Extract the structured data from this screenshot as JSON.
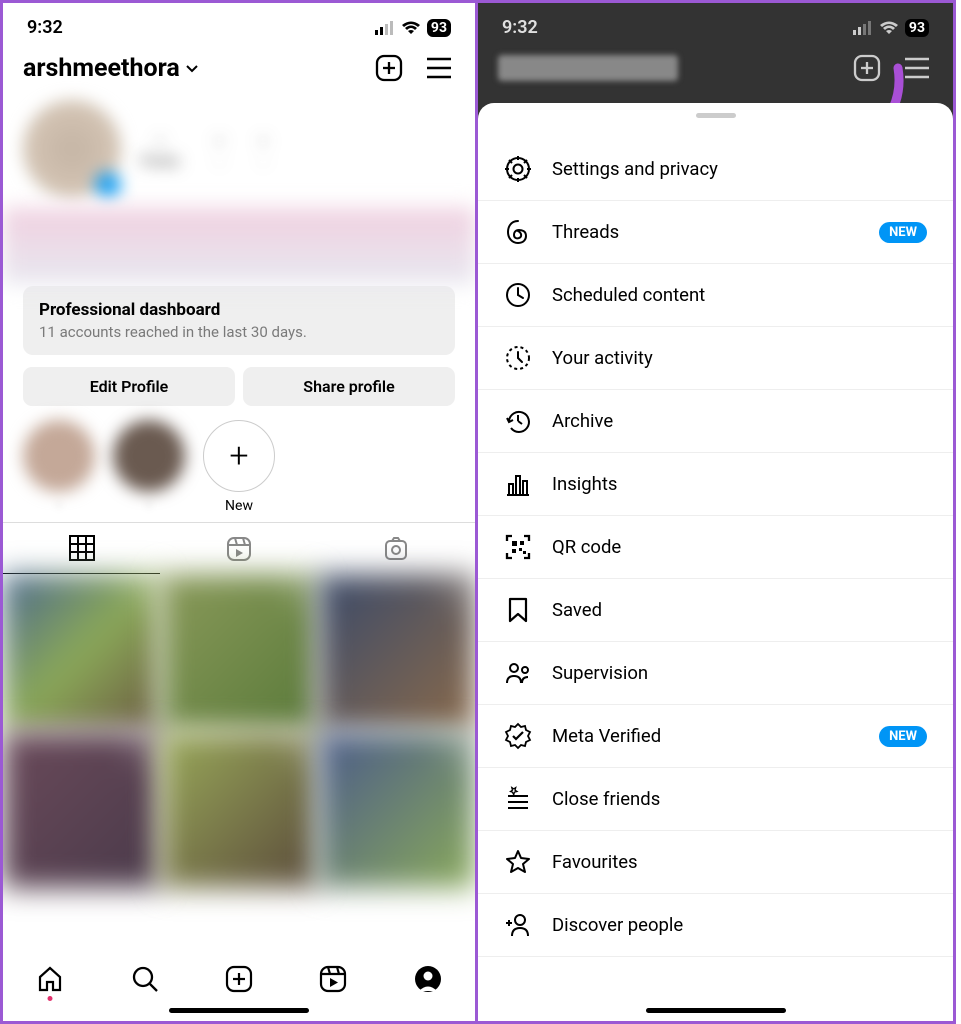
{
  "status": {
    "time": "9:32",
    "battery": "93"
  },
  "profile": {
    "username": "arshmeethora",
    "posts_label": "Posts",
    "dash_title": "Professional dashboard",
    "dash_sub": "11 accounts reached in the last 30 days.",
    "edit_btn": "Edit Profile",
    "share_btn": "Share profile",
    "highlight_new": "New"
  },
  "menu": {
    "items": [
      {
        "label": "Settings and privacy",
        "icon": "gear"
      },
      {
        "label": "Threads",
        "icon": "threads",
        "badge": "NEW"
      },
      {
        "label": "Scheduled content",
        "icon": "clock"
      },
      {
        "label": "Your activity",
        "icon": "activity"
      },
      {
        "label": "Archive",
        "icon": "archive"
      },
      {
        "label": "Insights",
        "icon": "insights"
      },
      {
        "label": "QR code",
        "icon": "qr"
      },
      {
        "label": "Saved",
        "icon": "saved"
      },
      {
        "label": "Supervision",
        "icon": "supervision"
      },
      {
        "label": "Meta Verified",
        "icon": "verified",
        "badge": "NEW"
      },
      {
        "label": "Close friends",
        "icon": "closefriends"
      },
      {
        "label": "Favourites",
        "icon": "star"
      },
      {
        "label": "Discover people",
        "icon": "discover"
      }
    ]
  },
  "colors": {
    "accent": "#9b59d4",
    "blue": "#0095f6"
  }
}
